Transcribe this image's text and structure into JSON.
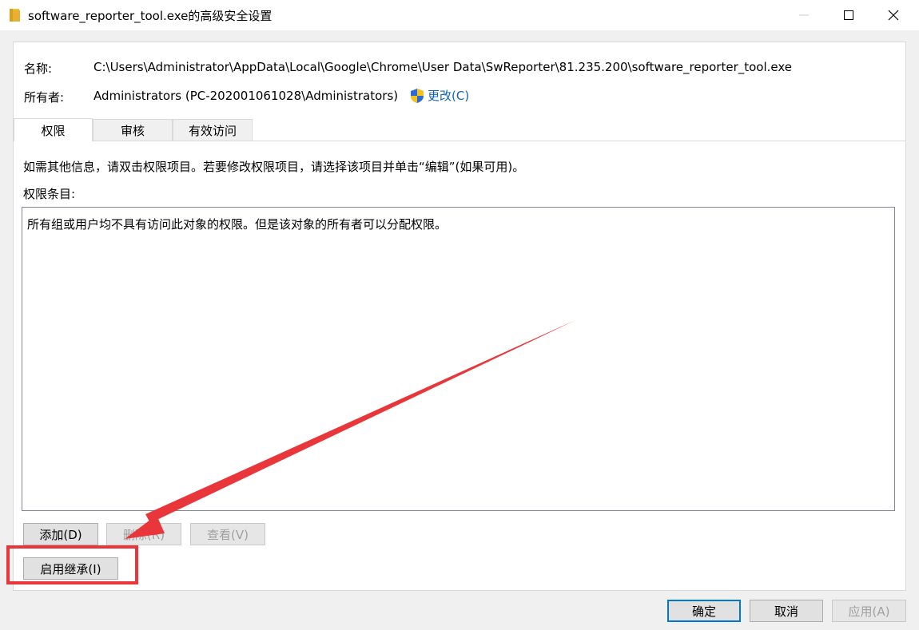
{
  "window": {
    "title": "software_reporter_tool.exe的高级安全设置"
  },
  "info": {
    "name_label": "名称:",
    "name_value": "C:\\Users\\Administrator\\AppData\\Local\\Google\\Chrome\\User Data\\SwReporter\\81.235.200\\software_reporter_tool.exe",
    "owner_label": "所有者:",
    "owner_value": "Administrators (PC-202001061028\\Administrators)",
    "change_label": "更改(C)"
  },
  "tabs": [
    {
      "label": "权限",
      "active": true
    },
    {
      "label": "审核",
      "active": false
    },
    {
      "label": "有效访问",
      "active": false
    }
  ],
  "permissions": {
    "hint": "如需其他信息，请双击权限项目。若要修改权限项目，请选择该项目并单击“编辑”(如果可用)。",
    "entries_label": "权限条目:",
    "empty_message": "所有组或用户均不具有访问此对象的权限。但是该对象的所有者可以分配权限。"
  },
  "buttons": {
    "add": "添加(D)",
    "delete": "删除(R)",
    "view": "查看(V)",
    "enable_inheritance": "启用继承(I)",
    "ok": "确定",
    "cancel": "取消",
    "apply": "应用(A)"
  },
  "icons": {
    "title": "folder-icon",
    "shield": "uac-shield-icon"
  },
  "colors": {
    "link": "#1463b4",
    "annotation": "#e8363a",
    "default_button_border": "#0078d7"
  }
}
